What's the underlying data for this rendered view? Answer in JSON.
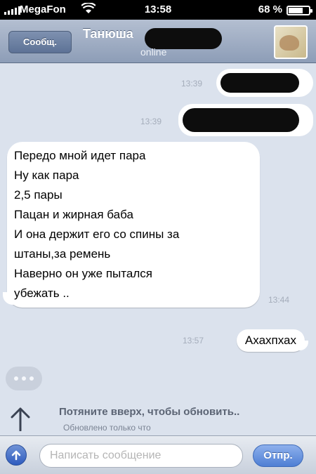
{
  "status_bar": {
    "carrier": "MegaFon",
    "time": "13:58",
    "battery_text": "68 %",
    "battery_level": 0.68
  },
  "nav": {
    "back_label": "Сообщ.",
    "contact_name": "Танюша",
    "subtitle": "online"
  },
  "messages": [
    {
      "direction": "outgoing",
      "time": "13:39",
      "redacted": true
    },
    {
      "direction": "outgoing",
      "time": "13:39",
      "redacted": true
    },
    {
      "direction": "incoming",
      "time": "13:44",
      "lines": [
        "Передо мной идет пара",
        "Ну как пара",
        "2,5 пары",
        "Пацан и жирная баба",
        "И она держит его со спины за",
        "штаны,за ремень",
        "Наверно он уже пытался",
        "убежать .."
      ]
    },
    {
      "direction": "outgoing",
      "time": "13:57",
      "text": "Ахахпхах"
    }
  ],
  "pull_to_refresh": {
    "text": "Потяните вверх, чтобы обновить..",
    "subtext": "Обновлено только что"
  },
  "composer": {
    "placeholder": "Написать сообщение",
    "send_label": "Отпр."
  },
  "icons": {
    "wifi": "wifi-icon",
    "attach": "attach-icon",
    "arrow": "arrow-up-icon"
  }
}
